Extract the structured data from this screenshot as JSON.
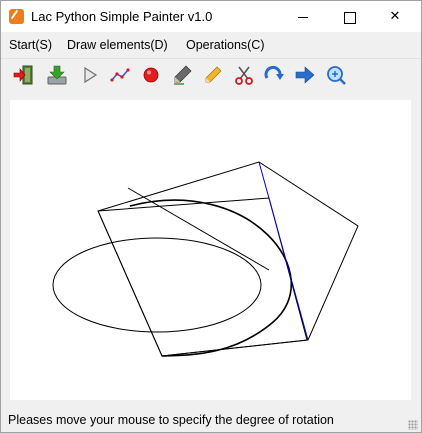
{
  "window": {
    "title": "Lac Python Simple Painter v1.0",
    "icon": "app-logo-icon"
  },
  "menubar": {
    "items": [
      {
        "label": "Start(S)"
      },
      {
        "label": "Draw elements(D)"
      },
      {
        "label": "Operations(C)"
      }
    ]
  },
  "toolbar": {
    "tools": [
      {
        "icon": "exit-icon"
      },
      {
        "icon": "save-icon"
      },
      {
        "icon": "play-icon"
      },
      {
        "icon": "polyline-icon"
      },
      {
        "icon": "record-icon"
      },
      {
        "icon": "pen-icon"
      },
      {
        "icon": "pencil-icon"
      },
      {
        "icon": "scissors-icon"
      },
      {
        "icon": "rotate-icon"
      },
      {
        "icon": "forward-arrow-icon"
      },
      {
        "icon": "zoom-in-icon"
      }
    ]
  },
  "statusbar": {
    "message": "Pleases move your mouse to specify the degree of rotation"
  },
  "colors": {
    "canvas_bg": "#ffffff",
    "stroke": "#000000",
    "highlight_line": "#0000cc",
    "window_bg": "#f0f0f0"
  }
}
